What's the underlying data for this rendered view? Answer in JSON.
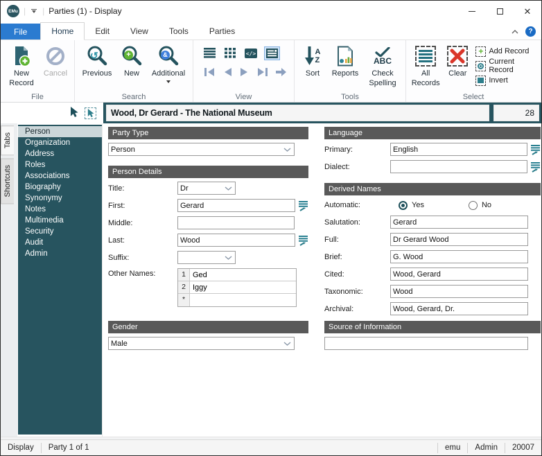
{
  "window": {
    "logo_text": "EMu",
    "title": "Parties (1) - Display"
  },
  "ribbon": {
    "tabs": [
      "File",
      "Home",
      "Edit",
      "View",
      "Tools",
      "Parties"
    ],
    "active_tab": "Home",
    "groups": {
      "file": {
        "label": "File",
        "new_record": "New Record",
        "cancel": "Cancel"
      },
      "search": {
        "label": "Search",
        "previous": "Previous",
        "new": "New",
        "additional": "Additional"
      },
      "view": {
        "label": "View"
      },
      "tools": {
        "label": "Tools",
        "sort": "Sort",
        "reports": "Reports",
        "check_spelling": "Check Spelling"
      },
      "select": {
        "label": "Select",
        "all_records": "All Records",
        "clear": "Clear",
        "add_record": "Add Record",
        "current_record": "Current Record",
        "invert": "Invert"
      }
    }
  },
  "record_header": {
    "title": "Wood, Dr Gerard - The National Museum",
    "count": "28"
  },
  "sidebar": {
    "rail": [
      "Tabs",
      "Shortcuts"
    ],
    "items": [
      "Person",
      "Organization",
      "Address",
      "Roles",
      "Associations",
      "Biography",
      "Synonymy",
      "Notes",
      "Multimedia",
      "Security",
      "Audit",
      "Admin"
    ],
    "selected": "Person"
  },
  "form": {
    "party_type": {
      "header": "Party Type",
      "value": "Person"
    },
    "person_details": {
      "header": "Person Details",
      "title_label": "Title:",
      "title_value": "Dr",
      "first_label": "First:",
      "first_value": "Gerard",
      "middle_label": "Middle:",
      "middle_value": "",
      "last_label": "Last:",
      "last_value": "Wood",
      "suffix_label": "Suffix:",
      "suffix_value": "",
      "other_names_label": "Other Names:",
      "other_names": [
        {
          "row": "1",
          "value": "Ged"
        },
        {
          "row": "2",
          "value": "Iggy"
        }
      ],
      "new_row_marker": "*"
    },
    "gender": {
      "header": "Gender",
      "value": "Male"
    },
    "language": {
      "header": "Language",
      "primary_label": "Primary:",
      "primary_value": "English",
      "dialect_label": "Dialect:",
      "dialect_value": ""
    },
    "derived_names": {
      "header": "Derived Names",
      "automatic_label": "Automatic:",
      "yes_label": "Yes",
      "no_label": "No",
      "automatic_value": "Yes",
      "rows": [
        {
          "label": "Salutation:",
          "value": "Gerard"
        },
        {
          "label": "Full:",
          "value": "Dr Gerard Wood"
        },
        {
          "label": "Brief:",
          "value": "G. Wood"
        },
        {
          "label": "Cited:",
          "value": "Wood, Gerard"
        },
        {
          "label": "Taxonomic:",
          "value": "Wood"
        },
        {
          "label": "Archival:",
          "value": "Wood, Gerard, Dr."
        }
      ]
    },
    "source": {
      "header": "Source of Information",
      "value": ""
    }
  },
  "status_bar": {
    "mode": "Display",
    "record_position": "Party 1 of 1",
    "connection": "emu",
    "user": "Admin",
    "port": "20007"
  },
  "colors": {
    "accent_blue": "#2b7bd0",
    "panel_teal": "#27545f",
    "section_header_gray": "#595959",
    "icon_teal": "#24535e",
    "lookup_teal": "#1f7a8c",
    "badge_green": "#5fb432",
    "badge_red": "#da362a",
    "badge_blue": "#3d7edb",
    "nav_arrow_gray": "#8ca0bf"
  }
}
